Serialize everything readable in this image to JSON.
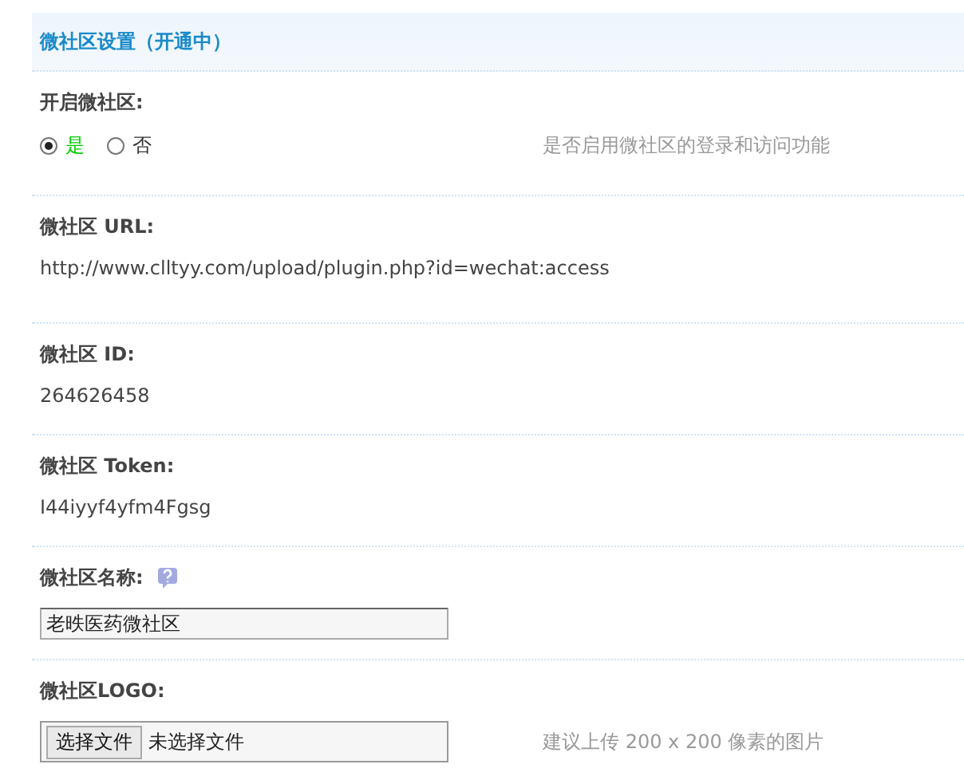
{
  "section": {
    "title": "微社区设置（开通中）"
  },
  "rows": [
    {
      "kind": "radio",
      "label": "开启微社区:",
      "options": [
        {
          "label": "是",
          "selected": true
        },
        {
          "label": "否",
          "selected": false
        }
      ],
      "hint": "是否启用微社区的登录和访问功能"
    },
    {
      "kind": "text",
      "label": "微社区 URL:",
      "value": "http://www.clltyy.com/upload/plugin.php?id=wechat:access"
    },
    {
      "kind": "text",
      "label": "微社区 ID:",
      "value": "264626458"
    },
    {
      "kind": "text",
      "label": "微社区 Token:",
      "value": "I44iyyf4yfm4Fgsg"
    },
    {
      "kind": "input",
      "label": "微社区名称:",
      "help": true,
      "value": "老昳医药微社区"
    },
    {
      "kind": "file",
      "label": "微社区LOGO:",
      "button": "选择文件",
      "status": "未选择文件",
      "hint": "建议上传 200 x 200 像素的图片"
    }
  ]
}
